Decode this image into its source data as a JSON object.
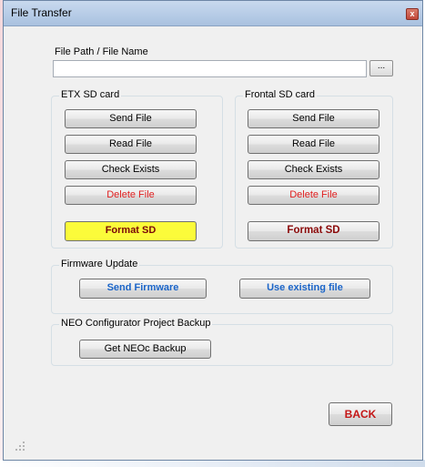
{
  "window": {
    "title": "File Transfer",
    "close_glyph": "x"
  },
  "file_path": {
    "label": "File Path / File Name",
    "value": "",
    "browse_label": "..."
  },
  "etx_group": {
    "title": "ETX SD card",
    "buttons": {
      "send": "Send File",
      "read": "Read File",
      "check": "Check Exists",
      "delete": "Delete File",
      "format": "Format SD"
    }
  },
  "frontal_group": {
    "title": "Frontal SD card",
    "buttons": {
      "send": "Send File",
      "read": "Read File",
      "check": "Check Exists",
      "delete": "Delete File",
      "format": "Format SD"
    }
  },
  "firmware_group": {
    "title": "Firmware Update",
    "send_label": "Send Firmware",
    "existing_label": "Use existing file"
  },
  "backup_group": {
    "title": "NEO Configurator Project Backup",
    "backup_label": "Get NEOc Backup"
  },
  "back_label": "BACK",
  "colors": {
    "highlight": "#fbfb3a",
    "delete_text": "#e02020",
    "format_text": "#8b0a0a",
    "firmware_text": "#1a64c8",
    "back_text": "#c41616"
  }
}
